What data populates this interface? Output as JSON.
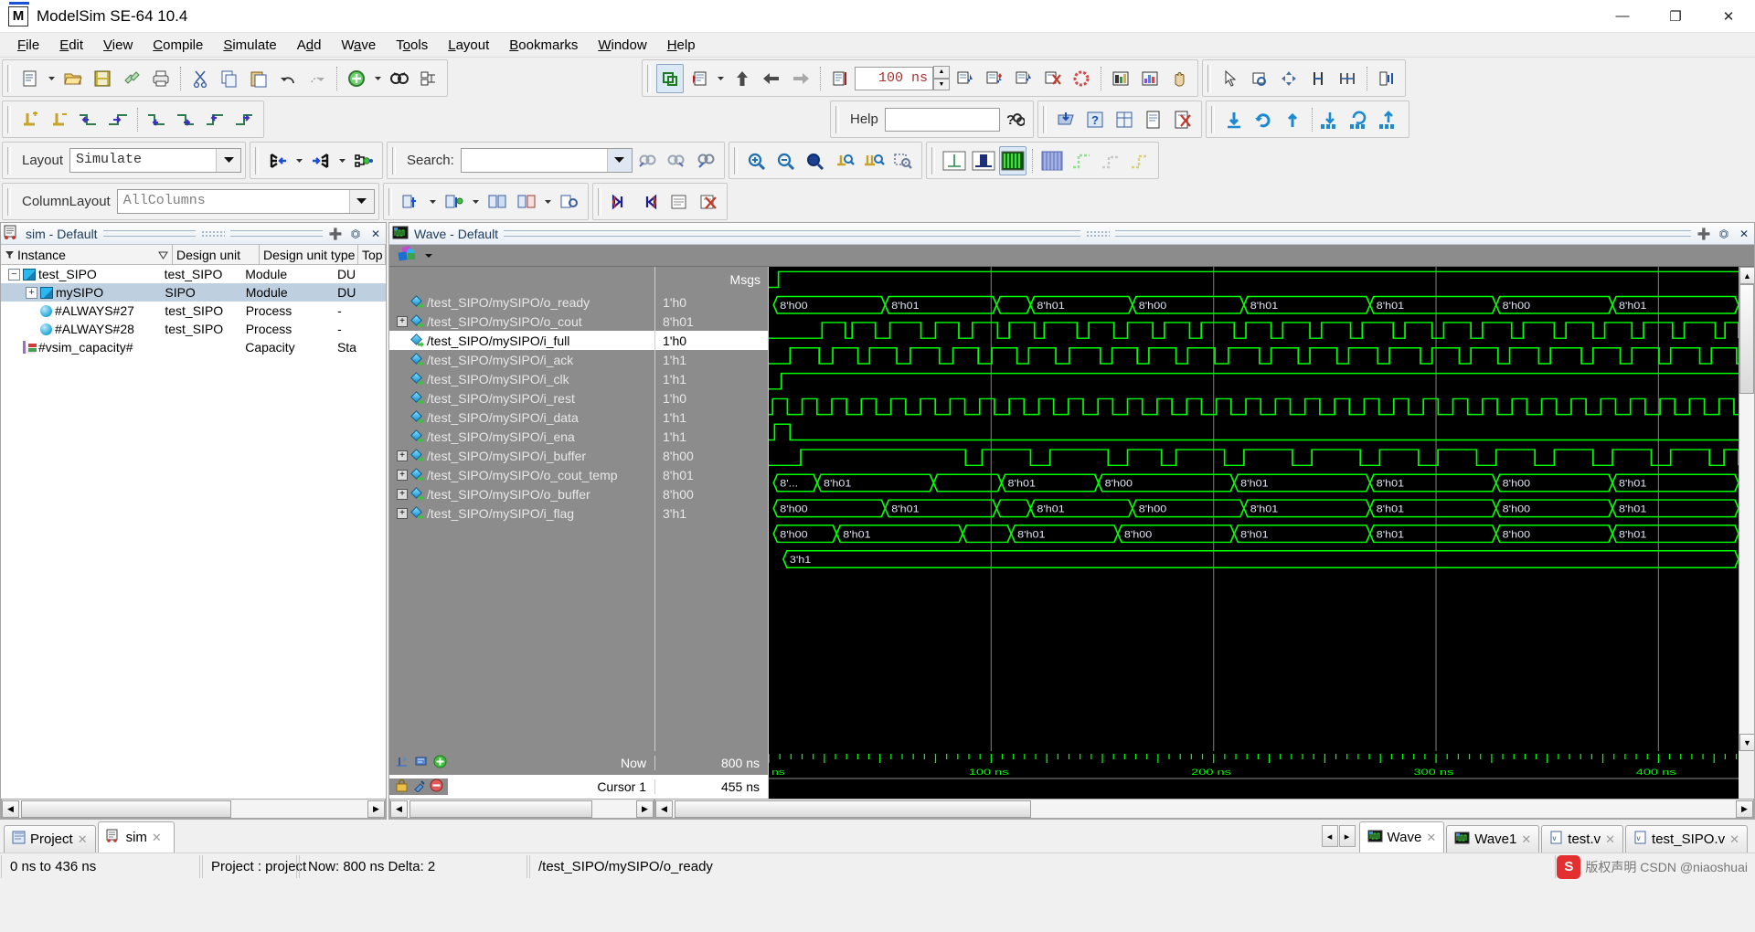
{
  "window": {
    "title": "ModelSim SE-64 10.4",
    "app_icon": "M",
    "minimize": "—",
    "maximize": "❐",
    "close": "✕"
  },
  "menubar": [
    {
      "label": "File",
      "accel": "F"
    },
    {
      "label": "Edit",
      "accel": "E"
    },
    {
      "label": "View",
      "accel": "V"
    },
    {
      "label": "Compile",
      "accel": "C"
    },
    {
      "label": "Simulate",
      "accel": "S"
    },
    {
      "label": "Add",
      "accel": "d"
    },
    {
      "label": "Wave",
      "accel": "a"
    },
    {
      "label": "Tools",
      "accel": "o"
    },
    {
      "label": "Layout",
      "accel": "L"
    },
    {
      "label": "Bookmarks",
      "accel": "B"
    },
    {
      "label": "Window",
      "accel": "W"
    },
    {
      "label": "Help",
      "accel": "H"
    }
  ],
  "toolbar": {
    "run_length": "100 ns",
    "help_label": "Help",
    "help_value": "",
    "layout_label": "Layout",
    "layout_value": "Simulate",
    "search_label": "Search:",
    "search_value": "",
    "columnlayout_label": "ColumnLayout",
    "columnlayout_value": "AllColumns"
  },
  "sim_pane": {
    "title": "sim - Default",
    "columns": [
      "Instance",
      "Design unit",
      "Design unit type",
      "Top"
    ],
    "rows": [
      {
        "name": "test_SIPO",
        "design_unit": "test_SIPO",
        "type": "Module",
        "top": "DU",
        "indent": 0,
        "expander": "−",
        "icon": "module-icon",
        "selected": false
      },
      {
        "name": "mySIPO",
        "design_unit": "SIPO",
        "type": "Module",
        "top": "DU",
        "indent": 1,
        "expander": "+",
        "icon": "module-icon",
        "selected": true
      },
      {
        "name": "#ALWAYS#27",
        "design_unit": "test_SIPO",
        "type": "Process",
        "top": "-",
        "indent": 1,
        "expander": "",
        "icon": "process-icon",
        "selected": false
      },
      {
        "name": "#ALWAYS#28",
        "design_unit": "test_SIPO",
        "type": "Process",
        "top": "-",
        "indent": 1,
        "expander": "",
        "icon": "process-icon",
        "selected": false
      },
      {
        "name": "#vsim_capacity#",
        "design_unit": "",
        "type": "Capacity",
        "top": "Sta",
        "indent": 0,
        "expander": "",
        "icon": "capacity-icon",
        "selected": false
      }
    ]
  },
  "wave_pane": {
    "title": "Wave - Default",
    "msgs_header": "Msgs",
    "signals": [
      {
        "name": "/test_SIPO/mySIPO/o_ready",
        "value": "1'h0",
        "expandable": false,
        "kind": "out",
        "highlight": false
      },
      {
        "name": "/test_SIPO/mySIPO/o_cout",
        "value": "8'h01",
        "expandable": true,
        "kind": "out",
        "highlight": false
      },
      {
        "name": "/test_SIPO/mySIPO/i_full",
        "value": "1'h0",
        "expandable": false,
        "kind": "out",
        "highlight": true
      },
      {
        "name": "/test_SIPO/mySIPO/i_ack",
        "value": "1'h1",
        "expandable": false,
        "kind": "out",
        "highlight": false
      },
      {
        "name": "/test_SIPO/mySIPO/i_clk",
        "value": "1'h1",
        "expandable": false,
        "kind": "in",
        "highlight": false
      },
      {
        "name": "/test_SIPO/mySIPO/i_rest",
        "value": "1'h0",
        "expandable": false,
        "kind": "in",
        "highlight": false
      },
      {
        "name": "/test_SIPO/mySIPO/i_data",
        "value": "1'h1",
        "expandable": false,
        "kind": "in",
        "highlight": false
      },
      {
        "name": "/test_SIPO/mySIPO/i_ena",
        "value": "1'h1",
        "expandable": false,
        "kind": "in",
        "highlight": false
      },
      {
        "name": "/test_SIPO/mySIPO/i_buffer",
        "value": "8'h00",
        "expandable": true,
        "kind": "sig",
        "highlight": false
      },
      {
        "name": "/test_SIPO/mySIPO/o_cout_temp",
        "value": "8'h01",
        "expandable": true,
        "kind": "sig",
        "highlight": false
      },
      {
        "name": "/test_SIPO/mySIPO/o_buffer",
        "value": "8'h00",
        "expandable": true,
        "kind": "sig",
        "highlight": false
      },
      {
        "name": "/test_SIPO/mySIPO/i_flag",
        "value": "3'h1",
        "expandable": true,
        "kind": "sig",
        "highlight": false
      }
    ],
    "now_label": "Now",
    "now_value": "800 ns",
    "cursor_label": "Cursor 1",
    "cursor_value": "455 ns",
    "ruler": {
      "unit_label": "ns",
      "ticks": [
        "100 ns",
        "200 ns",
        "300 ns",
        "400 ns"
      ],
      "range_start_ns": 0,
      "range_end_ns": 436
    }
  },
  "chart_data": {
    "type": "waveform",
    "time_unit": "ns",
    "x_range": [
      0,
      436
    ],
    "gridlines_ns": [
      100,
      200,
      300,
      400
    ],
    "cursor_ns": 455,
    "bus_rows": [
      {
        "signal": "/test_SIPO/mySIPO/o_cout",
        "segments": [
          {
            "label": "8'h00",
            "start": 0.5,
            "end": 12
          },
          {
            "label": "8'h01",
            "start": 12,
            "end": 23.5
          },
          {
            "label": "",
            "start": 23.5,
            "end": 27
          },
          {
            "label": "8'h01",
            "start": 27,
            "end": 37.5
          },
          {
            "label": "8'h00",
            "start": 37.5,
            "end": 49
          },
          {
            "label": "8'h01",
            "start": 49,
            "end": 62
          },
          {
            "label": "8'h01",
            "start": 62,
            "end": 75
          },
          {
            "label": "8'h00",
            "start": 75,
            "end": 87
          },
          {
            "label": "8'h01",
            "start": 87,
            "end": 100
          }
        ]
      },
      {
        "signal": "/test_SIPO/mySIPO/i_buffer",
        "segments": [
          {
            "label": "8'...",
            "start": 0.5,
            "end": 5
          },
          {
            "label": "8'h01",
            "start": 5,
            "end": 17
          },
          {
            "label": "",
            "start": 17,
            "end": 24
          },
          {
            "label": "8'h01",
            "start": 24,
            "end": 34
          },
          {
            "label": "8'h00",
            "start": 34,
            "end": 48
          },
          {
            "label": "8'h01",
            "start": 48,
            "end": 62
          },
          {
            "label": "8'h01",
            "start": 62,
            "end": 75
          },
          {
            "label": "8'h00",
            "start": 75,
            "end": 87
          },
          {
            "label": "8'h01",
            "start": 87,
            "end": 100
          }
        ]
      },
      {
        "signal": "/test_SIPO/mySIPO/o_cout_temp",
        "segments": [
          {
            "label": "8'h00",
            "start": 0.5,
            "end": 12
          },
          {
            "label": "8'h01",
            "start": 12,
            "end": 23.5
          },
          {
            "label": "",
            "start": 23.5,
            "end": 27
          },
          {
            "label": "8'h01",
            "start": 27,
            "end": 37.5
          },
          {
            "label": "8'h00",
            "start": 37.5,
            "end": 49
          },
          {
            "label": "8'h01",
            "start": 49,
            "end": 62
          },
          {
            "label": "8'h01",
            "start": 62,
            "end": 75
          },
          {
            "label": "8'h00",
            "start": 75,
            "end": 87
          },
          {
            "label": "8'h01",
            "start": 87,
            "end": 100
          }
        ]
      },
      {
        "signal": "/test_SIPO/mySIPO/o_buffer",
        "segments": [
          {
            "label": "8'h00",
            "start": 0.5,
            "end": 7
          },
          {
            "label": "8'h01",
            "start": 7,
            "end": 20
          },
          {
            "label": "",
            "start": 20,
            "end": 25
          },
          {
            "label": "8'h01",
            "start": 25,
            "end": 36
          },
          {
            "label": "8'h00",
            "start": 36,
            "end": 48
          },
          {
            "label": "8'h01",
            "start": 48,
            "end": 62
          },
          {
            "label": "8'h01",
            "start": 62,
            "end": 75
          },
          {
            "label": "8'h00",
            "start": 75,
            "end": 87
          },
          {
            "label": "8'h01",
            "start": 87,
            "end": 100
          }
        ]
      },
      {
        "signal": "/test_SIPO/mySIPO/i_flag",
        "segments": [
          {
            "label": "3'h1",
            "start": 1.5,
            "end": 100
          }
        ]
      }
    ]
  },
  "tabs_left": [
    {
      "label": "Project",
      "icon": "project-icon",
      "active": false
    },
    {
      "label": "sim",
      "icon": "sim-icon",
      "active": true
    }
  ],
  "tabs_right": [
    {
      "label": "Wave",
      "icon": "wave-icon",
      "active": true
    },
    {
      "label": "Wave1",
      "icon": "wave-icon",
      "active": false
    },
    {
      "label": "test.v",
      "icon": "verilog-icon",
      "active": false
    },
    {
      "label": "test_SIPO.v",
      "icon": "verilog-icon",
      "active": false
    }
  ],
  "statusbar": {
    "range": "0 ns to 436 ns",
    "project": "Project : project",
    "now": "Now: 800 ns  Delta: 2",
    "path": "/test_SIPO/mySIPO/o_ready",
    "watermark": "版权声明 CSDN @niaoshuai",
    "csdn": "S"
  },
  "colors": {
    "wave_green": "#00ff00",
    "wave_bg": "#000000",
    "panel_gray": "#8c8c8c",
    "selection_blue": "#bed0e0",
    "accent": "#1a4fd6"
  }
}
